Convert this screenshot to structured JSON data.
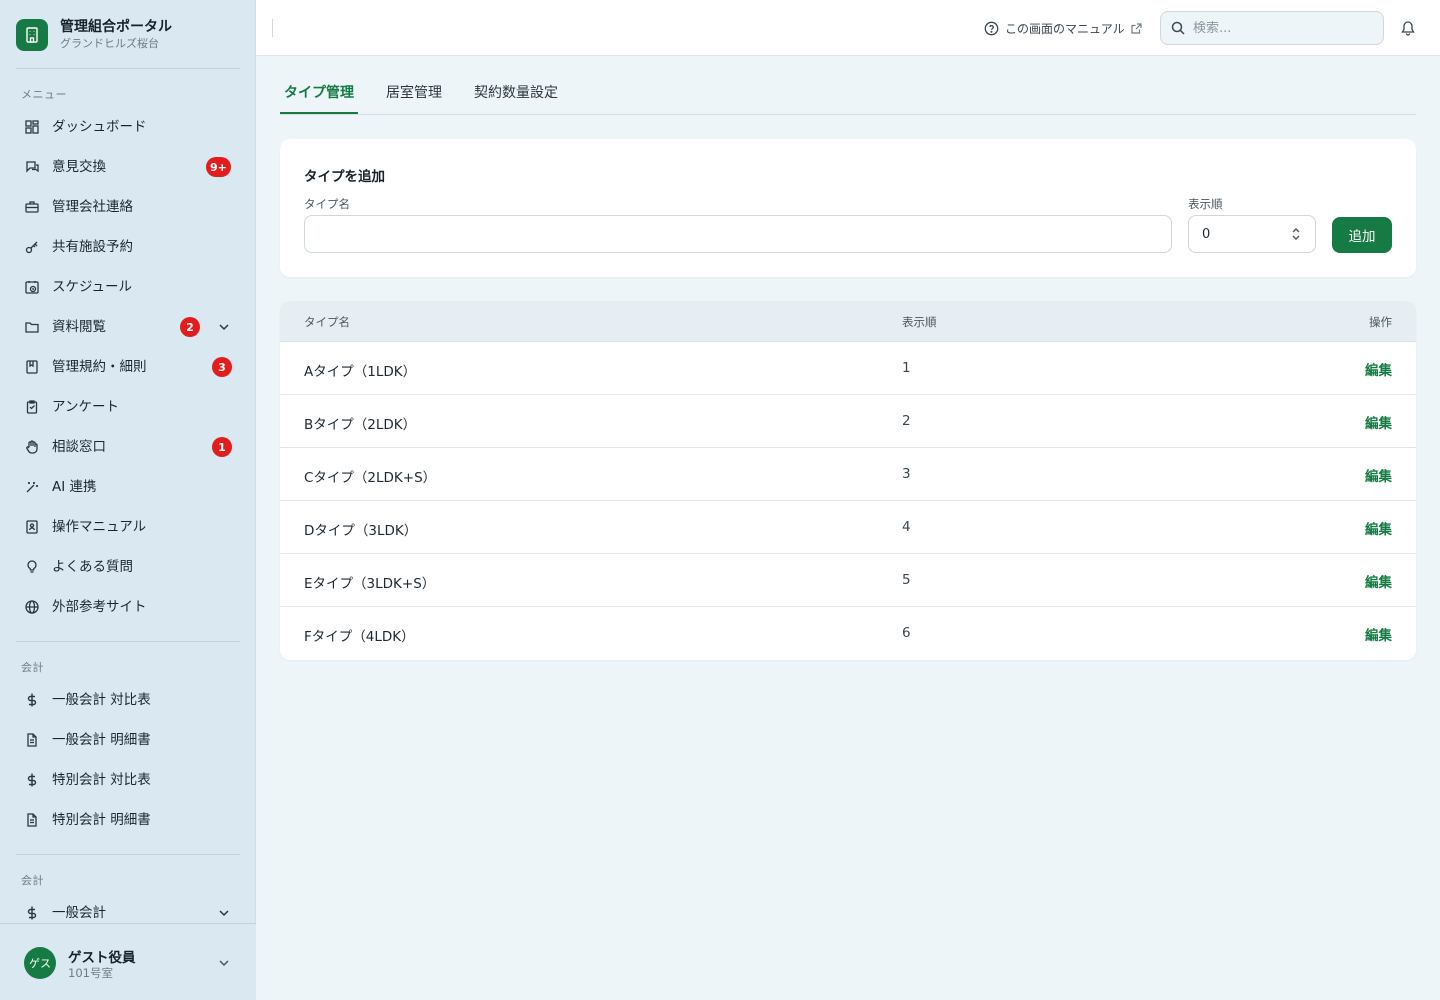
{
  "brand": {
    "title": "管理組合ポータル",
    "subtitle": "グランドヒルズ桜台"
  },
  "sidebar": {
    "menu_label": "メニュー",
    "items": [
      {
        "label": "ダッシュボード",
        "icon": "dashboard-icon"
      },
      {
        "label": "意見交換",
        "icon": "chat-icon",
        "badge": "9+"
      },
      {
        "label": "管理会社連絡",
        "icon": "briefcase-icon"
      },
      {
        "label": "共有施設予約",
        "icon": "key-icon"
      },
      {
        "label": "スケジュール",
        "icon": "calendar-clock-icon"
      },
      {
        "label": "資料閲覧",
        "icon": "folder-icon",
        "badge": "2"
      },
      {
        "label": "管理規約・細則",
        "icon": "book-icon",
        "badge": "3"
      },
      {
        "label": "アンケート",
        "icon": "clipboard-icon"
      },
      {
        "label": "相談窓口",
        "icon": "hand-icon",
        "badge": "1"
      },
      {
        "label": "AI 連携",
        "icon": "sparkle-wand-icon"
      },
      {
        "label": "操作マニュアル",
        "icon": "manual-book-icon"
      },
      {
        "label": "よくある質問",
        "icon": "lightbulb-icon"
      },
      {
        "label": "外部参考サイト",
        "icon": "globe-icon"
      }
    ],
    "accounting_label": "会計",
    "accounting_items": [
      {
        "label": "一般会計 対比表",
        "icon": "dollar-icon"
      },
      {
        "label": "一般会計 明細書",
        "icon": "document-icon"
      },
      {
        "label": "特別会計 対比表",
        "icon": "dollar-icon"
      },
      {
        "label": "特別会計 明細書",
        "icon": "document-icon"
      }
    ],
    "accounting2_label": "会計",
    "accounting2_items": [
      {
        "label": "一般会計",
        "icon": "dollar-icon"
      }
    ]
  },
  "user": {
    "avatar": "ゲス",
    "name": "ゲスト役員",
    "room": "101号室"
  },
  "header": {
    "manual_link": "この画面のマニュアル",
    "search_placeholder": "検索..."
  },
  "tabs": [
    {
      "label": "タイプ管理",
      "active": true
    },
    {
      "label": "居室管理",
      "active": false
    },
    {
      "label": "契約数量設定",
      "active": false
    }
  ],
  "add_form": {
    "title": "タイプを追加",
    "name_label": "タイプ名",
    "name_value": "",
    "order_label": "表示順",
    "order_value": "0",
    "submit_label": "追加"
  },
  "table": {
    "headers": {
      "name": "タイプ名",
      "order": "表示順",
      "action": "操作"
    },
    "rows": [
      {
        "name": "Aタイプ（1LDK）",
        "order": "1",
        "action": "編集"
      },
      {
        "name": "Bタイプ（2LDK）",
        "order": "2",
        "action": "編集"
      },
      {
        "name": "Cタイプ（2LDK+S）",
        "order": "3",
        "action": "編集"
      },
      {
        "name": "Dタイプ（3LDK）",
        "order": "4",
        "action": "編集"
      },
      {
        "name": "Eタイプ（3LDK+S）",
        "order": "5",
        "action": "編集"
      },
      {
        "name": "Fタイプ（4LDK）",
        "order": "6",
        "action": "編集"
      }
    ]
  },
  "colors": {
    "accent": "#167a44",
    "badge": "#e11d1d",
    "sidebar_bg": "#d9e8f1",
    "page_bg": "#eef5f9"
  }
}
